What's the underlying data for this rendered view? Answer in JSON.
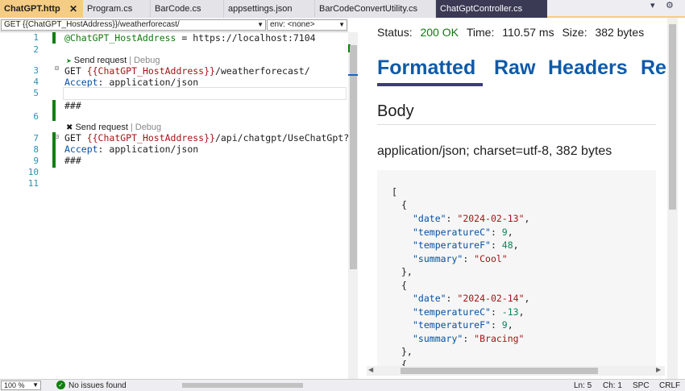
{
  "tabs": [
    {
      "label": "ChatGPT.http",
      "active": true
    },
    {
      "label": "Program.cs"
    },
    {
      "label": "BarCode.cs"
    },
    {
      "label": "appsettings.json"
    },
    {
      "label": "BarCodeConvertUtility.cs"
    },
    {
      "label": "ChatGptController.cs"
    }
  ],
  "request_bar": {
    "url_select": "GET {{ChatGPT_HostAddress}}/weatherforecast/",
    "env_select": "env: <none>"
  },
  "editor": {
    "line_numbers": [
      "1",
      "2",
      "3",
      "4",
      "5",
      "6",
      "7",
      "8",
      "9",
      "10",
      "11"
    ],
    "line1": {
      "var": "@ChatGPT_HostAddress",
      "rest": " = https://localhost:7104"
    },
    "lens1": {
      "send": "Send request",
      "sep": "|",
      "debug": "Debug"
    },
    "line3": {
      "method": "GET ",
      "var": "{{ChatGPT_HostAddress}}",
      "path": "/weatherforecast/"
    },
    "line4": {
      "header": "Accept",
      "value": ": application/json"
    },
    "line6": "###",
    "lens2": {
      "send": "Send request",
      "sep": "|",
      "debug": "Debug"
    },
    "line8": {
      "method": "GET ",
      "var": "{{ChatGPT_HostAddress}}",
      "path": "/api/chatgpt/UseChatGpt?quer"
    },
    "line9": {
      "header": "Accept",
      "value": ": application/json"
    },
    "line10": "###"
  },
  "response": {
    "status_label": "Status:",
    "status_value": "200 OK",
    "time_label": "Time:",
    "time_value": "110.57 ms",
    "size_label": "Size:",
    "size_value": "382 bytes",
    "tabs": [
      "Formatted",
      "Raw",
      "Headers",
      "Re"
    ],
    "body_heading": "Body",
    "content_type": "application/json; charset=utf-8, 382 bytes",
    "json": {
      "open": "[",
      "obj_open": "{",
      "obj_close": "},",
      "k_date": "\"date\"",
      "k_tc": "\"temperatureC\"",
      "k_tf": "\"temperatureF\"",
      "k_sum": "\"summary\"",
      "item1": {
        "date": "\"2024-02-13\"",
        "tc": "9",
        "tf": "48",
        "summary": "\"Cool\""
      },
      "item2": {
        "date": "\"2024-02-14\"",
        "tc": "-13",
        "tf": "9",
        "summary": "\"Bracing\""
      }
    }
  },
  "status_bar": {
    "zoom": "100 %",
    "issues": "No issues found",
    "ln": "Ln: 5",
    "ch": "Ch: 1",
    "spc": "SPC",
    "crlf": "CRLF"
  },
  "colors": {
    "active_tab": "#f5cc84",
    "gutter_bar": "#108010",
    "status_ok": "#0f7a0f",
    "link_blue": "#0f5aa8",
    "underline": "#3c3c7a"
  }
}
